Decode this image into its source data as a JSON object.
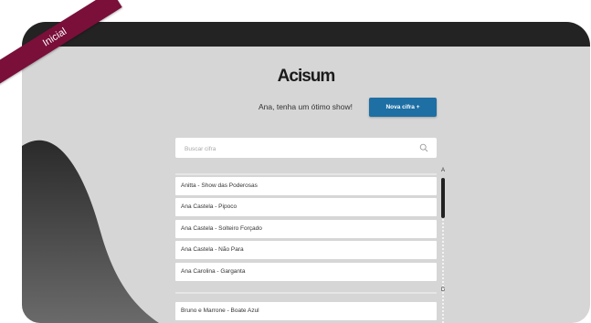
{
  "app": {
    "title": "Acisum"
  },
  "ribbon": {
    "label": "Inicial"
  },
  "header": {
    "greeting": "Ana, tenha um ótimo show!",
    "new_button_label": "Nova cifra +"
  },
  "search": {
    "placeholder": "Buscar cifra",
    "value": ""
  },
  "sections": [
    {
      "letter": "A",
      "songs": [
        "Anitta - Show das Poderosas",
        "Ana Castela - Pipoco",
        "Ana Castela - Solteiro Forçado",
        "Ana Castela - Não Para",
        "Ana Carolina - Garganta"
      ]
    },
    {
      "letter": "B",
      "songs": [
        "Bruno e Marrone - Boate Azul"
      ]
    }
  ],
  "colors": {
    "accent": "#1e6fa3",
    "ribbon": "#7a0f3a",
    "topbar": "#232323",
    "background": "#d6d6d6"
  }
}
